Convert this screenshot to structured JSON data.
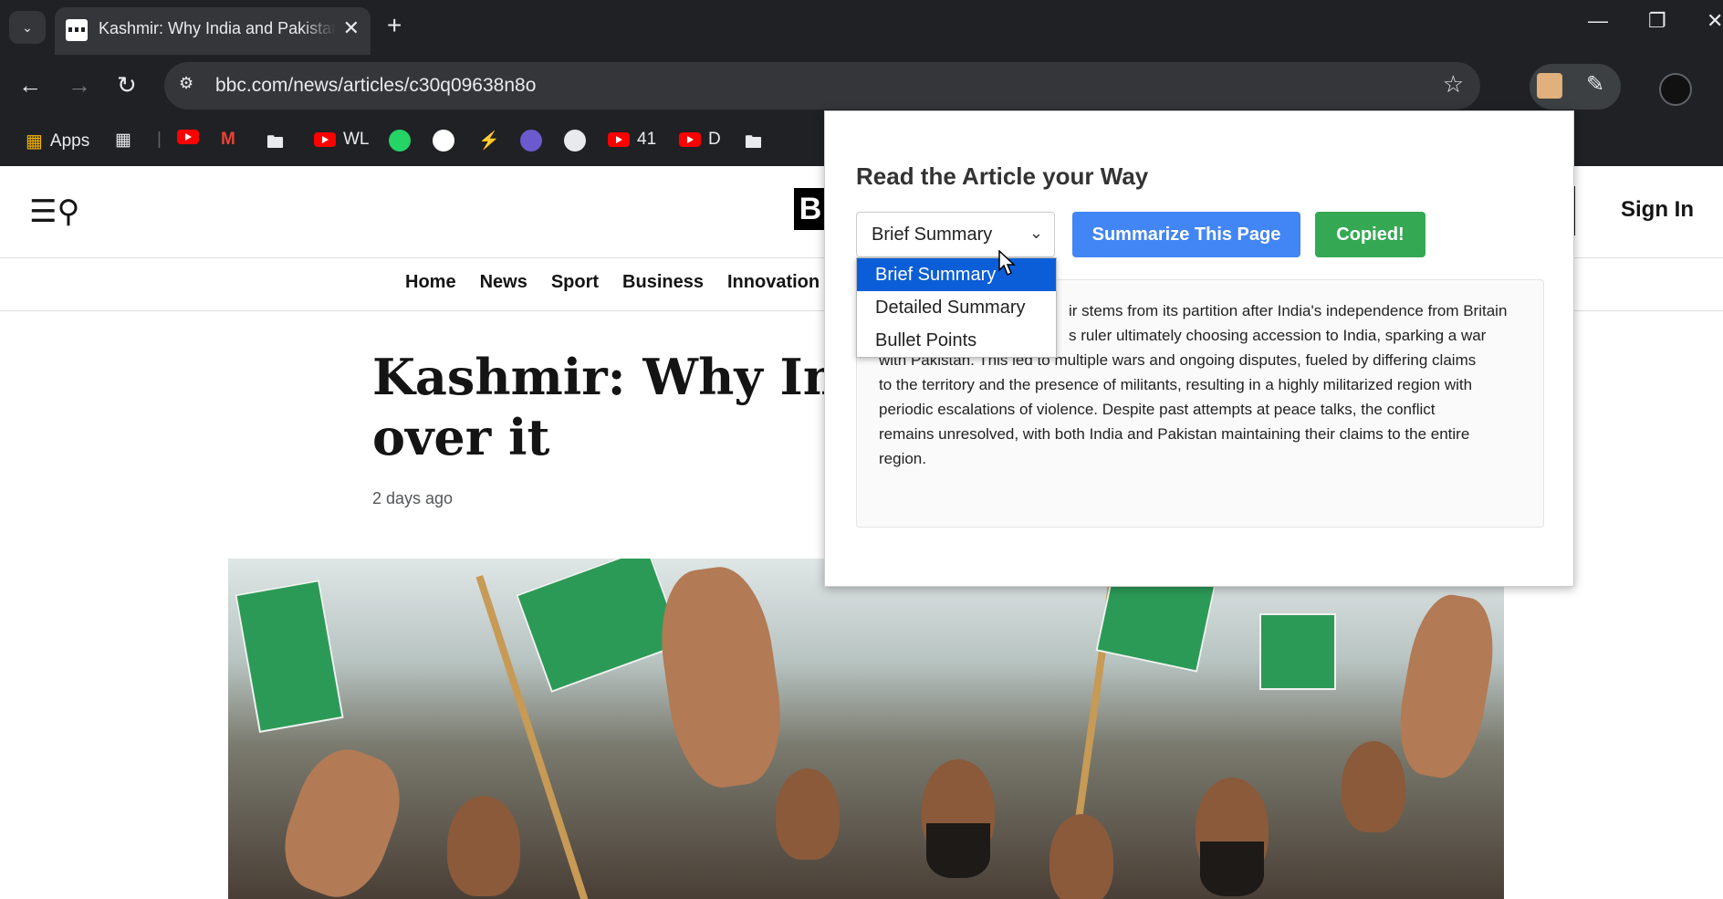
{
  "browser": {
    "tab_title": "Kashmir: Why India and Pakistan",
    "new_tab": "+",
    "url": "bbc.com/news/articles/c30q09638n8o",
    "bookmarks": [
      {
        "label": "Apps",
        "icon": "apps-grid-icon"
      },
      {
        "label": "WL",
        "icon": "youtube-icon"
      },
      {
        "label": "41",
        "icon": "youtube-icon"
      },
      {
        "label": "D",
        "icon": "youtube-icon"
      }
    ]
  },
  "page": {
    "sign_in": "Sign In",
    "nav": [
      "Home",
      "News",
      "Sport",
      "Business",
      "Innovation"
    ],
    "headline": "Kashmir: Why Indi",
    "headline_line2": "over it",
    "timestamp": "2 days ago",
    "logo_letter": "B"
  },
  "popup": {
    "title": "Read the Article your Way",
    "selected_option": "Brief Summary",
    "options": [
      "Brief Summary",
      "Detailed Summary",
      "Bullet Points"
    ],
    "summarize_button": "Summarize This Page",
    "copy_button": "Copied!",
    "summary_lines": [
      "ir stems from its partition after India's independence from Britain",
      "s ruler ultimately choosing accession to India, sparking a war",
      "with Pakistan.  This led to multiple wars and ongoing disputes, fueled by differing claims",
      "to the territory and the presence of militants, resulting in a highly militarized region with",
      "periodic escalations of violence.  Despite past attempts at peace talks, the conflict",
      "remains unresolved, with both India and Pakistan maintaining their claims to the entire",
      "region."
    ]
  }
}
